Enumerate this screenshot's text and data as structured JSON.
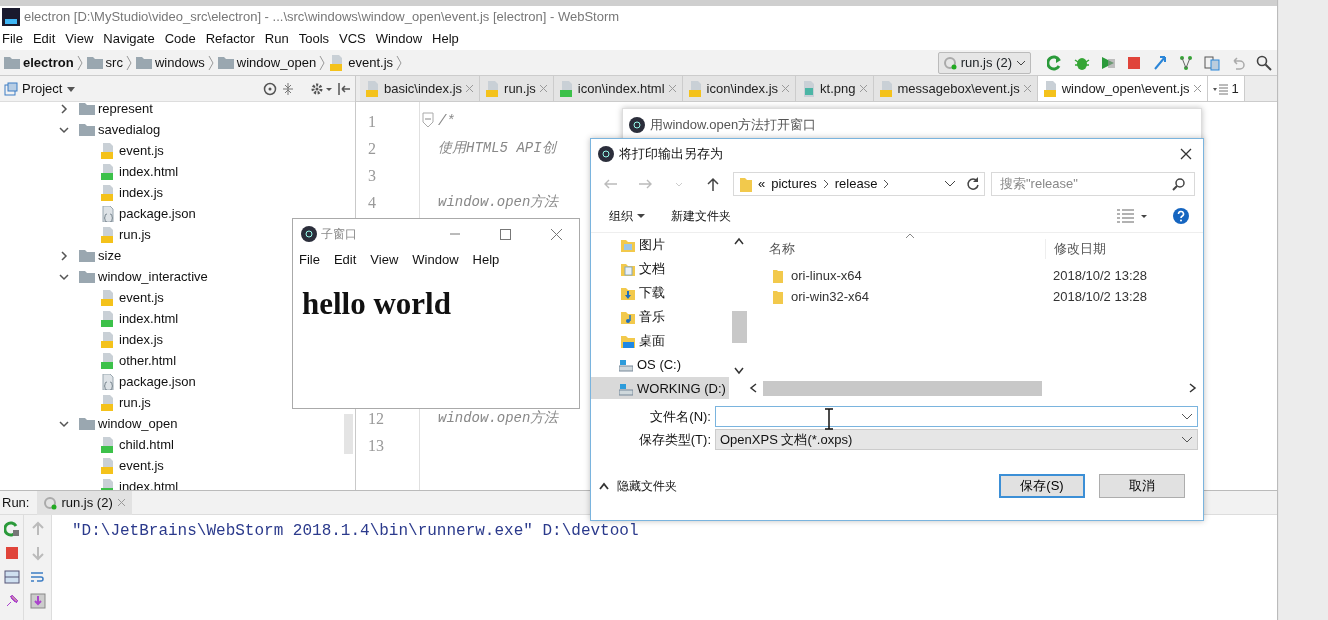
{
  "ide": {
    "title": "electron [D:\\MyStudio\\video_src\\electron] - ...\\src\\windows\\window_open\\event.js [electron] - WebStorm",
    "menu": [
      "File",
      "Edit",
      "View",
      "Navigate",
      "Code",
      "Refactor",
      "Run",
      "Tools",
      "VCS",
      "Window",
      "Help"
    ],
    "breadcrumb": [
      {
        "label": "electron",
        "kind": "folder"
      },
      {
        "label": "src",
        "kind": "folder"
      },
      {
        "label": "windows",
        "kind": "folder"
      },
      {
        "label": "window_open",
        "kind": "folder"
      },
      {
        "label": "event.js",
        "kind": "js"
      }
    ],
    "run_config": "run.js (2)",
    "project_panel": {
      "title": "Project",
      "tree": [
        {
          "label": "represent",
          "kind": "folder",
          "expanded": false
        },
        {
          "label": "savedialog",
          "kind": "folder",
          "expanded": true,
          "children": [
            {
              "label": "event.js",
              "kind": "js"
            },
            {
              "label": "index.html",
              "kind": "html"
            },
            {
              "label": "index.js",
              "kind": "js"
            },
            {
              "label": "package.json",
              "kind": "json"
            },
            {
              "label": "run.js",
              "kind": "js"
            }
          ]
        },
        {
          "label": "size",
          "kind": "folder",
          "expanded": false
        },
        {
          "label": "window_interactive",
          "kind": "folder",
          "expanded": true,
          "children": [
            {
              "label": "event.js",
              "kind": "js"
            },
            {
              "label": "index.html",
              "kind": "html"
            },
            {
              "label": "index.js",
              "kind": "js"
            },
            {
              "label": "other.html",
              "kind": "html"
            },
            {
              "label": "package.json",
              "kind": "json"
            },
            {
              "label": "run.js",
              "kind": "js"
            }
          ]
        },
        {
          "label": "window_open",
          "kind": "folder",
          "expanded": true,
          "children": [
            {
              "label": "child.html",
              "kind": "html"
            },
            {
              "label": "event.js",
              "kind": "js"
            },
            {
              "label": "index.html",
              "kind": "html"
            }
          ]
        }
      ]
    },
    "tabs": [
      {
        "label": "basic\\index.js",
        "kind": "js",
        "selected": false
      },
      {
        "label": "run.js",
        "kind": "js",
        "selected": false
      },
      {
        "label": "icon\\index.html",
        "kind": "html",
        "selected": false
      },
      {
        "label": "icon\\index.js",
        "kind": "js",
        "selected": false
      },
      {
        "label": "kt.png",
        "kind": "image",
        "selected": false
      },
      {
        "label": "messagebox\\event.js",
        "kind": "js",
        "selected": false
      },
      {
        "label": "window_open\\event.js",
        "kind": "js",
        "selected": true
      }
    ],
    "tab_overflow_count": "1",
    "code_lines": [
      {
        "number": "1",
        "text": "/*",
        "foldable": true
      },
      {
        "number": "2",
        "text": "使用HTML5 API创"
      },
      {
        "number": "3"
      },
      {
        "number": "4",
        "text": "window.open方法"
      },
      {
        "number": "12",
        "text": "window.open方法"
      },
      {
        "number": "13"
      }
    ],
    "run_panel": {
      "label": "Run:",
      "tab": "run.js (2)",
      "console": "\"D:\\JetBrains\\WebStorm 2018.1.4\\bin\\runnerw.exe\" D:\\devtool"
    }
  },
  "parent_window": {
    "title": "用window.open方法打开窗口"
  },
  "child_window": {
    "title": "子窗口",
    "menu": [
      "File",
      "Edit",
      "View",
      "Window",
      "Help"
    ],
    "heading": "hello world"
  },
  "save_dialog": {
    "title": "将打印输出另存为",
    "path_prefix": "«",
    "path": [
      "pictures",
      "release"
    ],
    "search_placeholder": "搜索\"release\"",
    "toolbar": [
      {
        "label": "组织",
        "dropdown": true
      },
      {
        "label": "新建文件夹",
        "dropdown": false
      }
    ],
    "nav_items": [
      {
        "label": "图片",
        "kind": "pictures",
        "selected": false
      },
      {
        "label": "文档",
        "kind": "documents",
        "selected": false
      },
      {
        "label": "下载",
        "kind": "downloads",
        "selected": false
      },
      {
        "label": "音乐",
        "kind": "music",
        "selected": false
      },
      {
        "label": "桌面",
        "kind": "desktop",
        "selected": false
      },
      {
        "label": "OS (C:)",
        "kind": "drive",
        "selected": false
      },
      {
        "label": "WORKING (D:)",
        "kind": "drive",
        "selected": true
      }
    ],
    "columns": [
      "名称",
      "修改日期"
    ],
    "files": [
      {
        "name": "ori-linux-x64",
        "modified": "2018/10/2 13:28"
      },
      {
        "name": "ori-win32-x64",
        "modified": "2018/10/2 13:28"
      }
    ],
    "file_name_label": "文件名(N):",
    "type_label": "保存类型(T):",
    "type_value": "OpenXPS 文档(*.oxps)",
    "hide_folders": "隐藏文件夹",
    "buttons": [
      {
        "label": "保存(S)",
        "primary": true
      },
      {
        "label": "取消",
        "primary": false
      }
    ]
  }
}
